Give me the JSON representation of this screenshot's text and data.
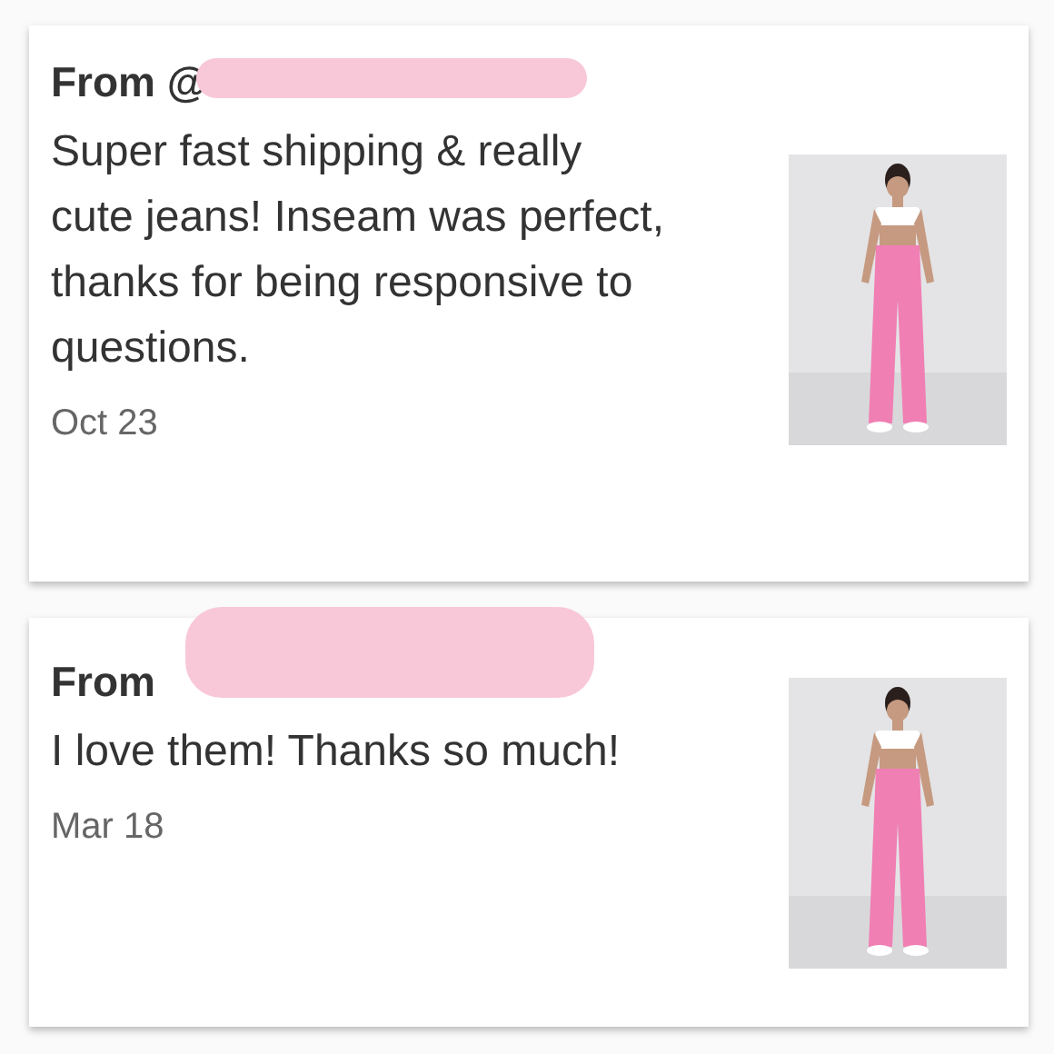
{
  "reviews": [
    {
      "from": "From @",
      "text": "Super fast shipping & really cute jeans! Inseam was perfect, thanks for being responsive to questions.",
      "date": "Oct 23"
    },
    {
      "from": "From",
      "text": "I love them! Thanks so much!",
      "date": "Mar 18"
    }
  ]
}
